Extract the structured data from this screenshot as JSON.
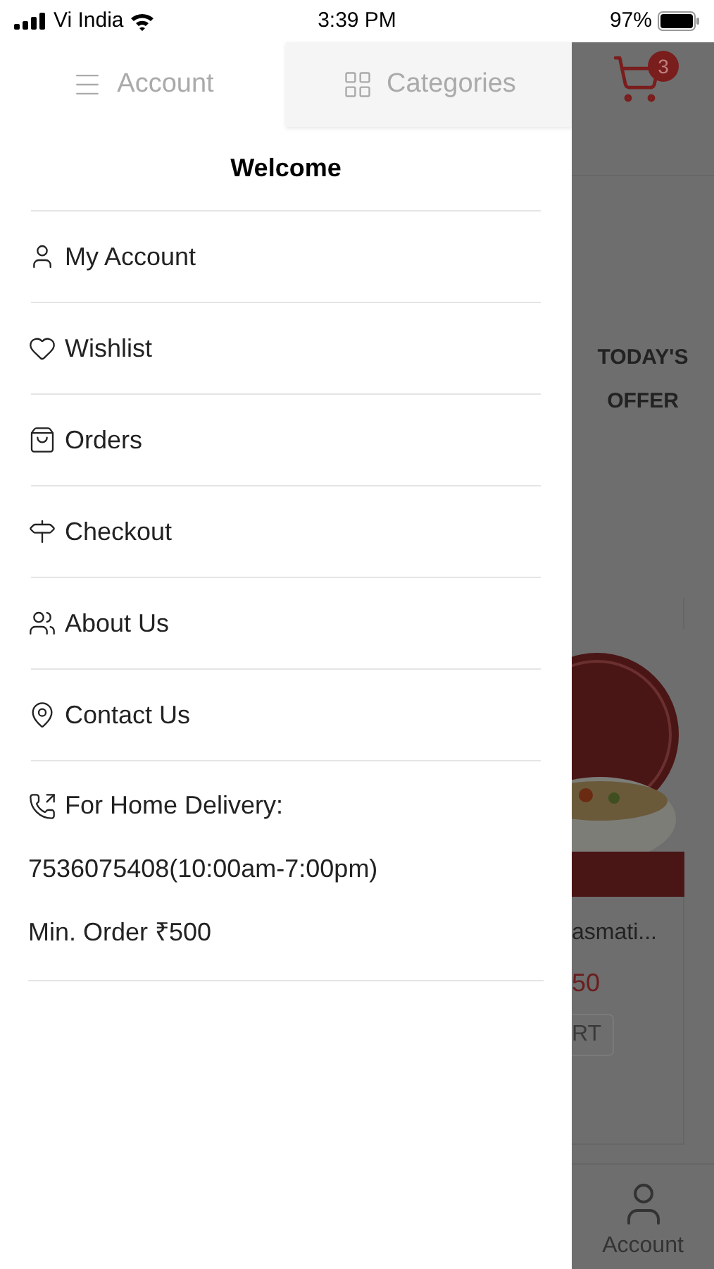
{
  "status_bar": {
    "carrier": "Vi India",
    "time": "3:39 PM",
    "battery": "97%"
  },
  "drawer": {
    "tabs": [
      {
        "label": "Account",
        "selected": true
      },
      {
        "label": "Categories",
        "selected": false
      }
    ],
    "title": "Welcome",
    "items": [
      {
        "label": "My Account"
      },
      {
        "label": "Wishlist"
      },
      {
        "label": "Orders"
      },
      {
        "label": "Checkout"
      },
      {
        "label": "About Us"
      },
      {
        "label": "Contact Us"
      }
    ],
    "delivery": {
      "label": "For Home Delivery:",
      "phone": "7536075408(10:00am-7:00pm)",
      "min_order": "Min. Order ₹500"
    }
  },
  "background": {
    "cart_count": "3",
    "offer_lines": [
      "TODAY'S",
      "OFFER"
    ],
    "product": {
      "name": "asmati...",
      "price": "50",
      "button": "RT"
    },
    "nav_label": "Account"
  }
}
